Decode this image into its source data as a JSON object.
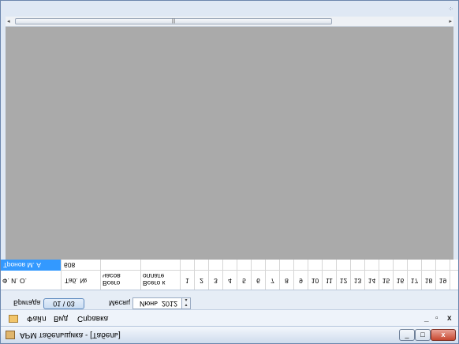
{
  "window": {
    "title": "АРМ табельщика - [Табель]",
    "controls": {
      "minimize": "_",
      "maximize": "□",
      "close": "x"
    }
  },
  "menu": {
    "items": [
      "Файл",
      "Вид",
      "Справка"
    ],
    "mdi_minimize": "_",
    "mdi_restore": "▫",
    "mdi_close": "x"
  },
  "filter": {
    "brigade_label": "Бригада",
    "brigade_value": "01 \\ 03",
    "month_label": "Месяц",
    "month_value": "Июнь",
    "year_value": "2012"
  },
  "grid": {
    "columns": [
      "Ф. И. О.",
      "Таб. №",
      "Всего часов",
      "Всего к оплате"
    ],
    "days": [
      "1",
      "2",
      "3",
      "4",
      "5",
      "6",
      "7",
      "8",
      "9",
      "10",
      "11",
      "12",
      "13",
      "14",
      "15",
      "16",
      "17",
      "18",
      "19"
    ],
    "rows": [
      {
        "fio": "Тронов М. А",
        "tab": "608",
        "hours": "",
        "pay": ""
      }
    ]
  },
  "colors": {
    "selection": "#3399ff",
    "mdi_background": "#aaaaaa",
    "chrome": "#dfe8f4"
  }
}
